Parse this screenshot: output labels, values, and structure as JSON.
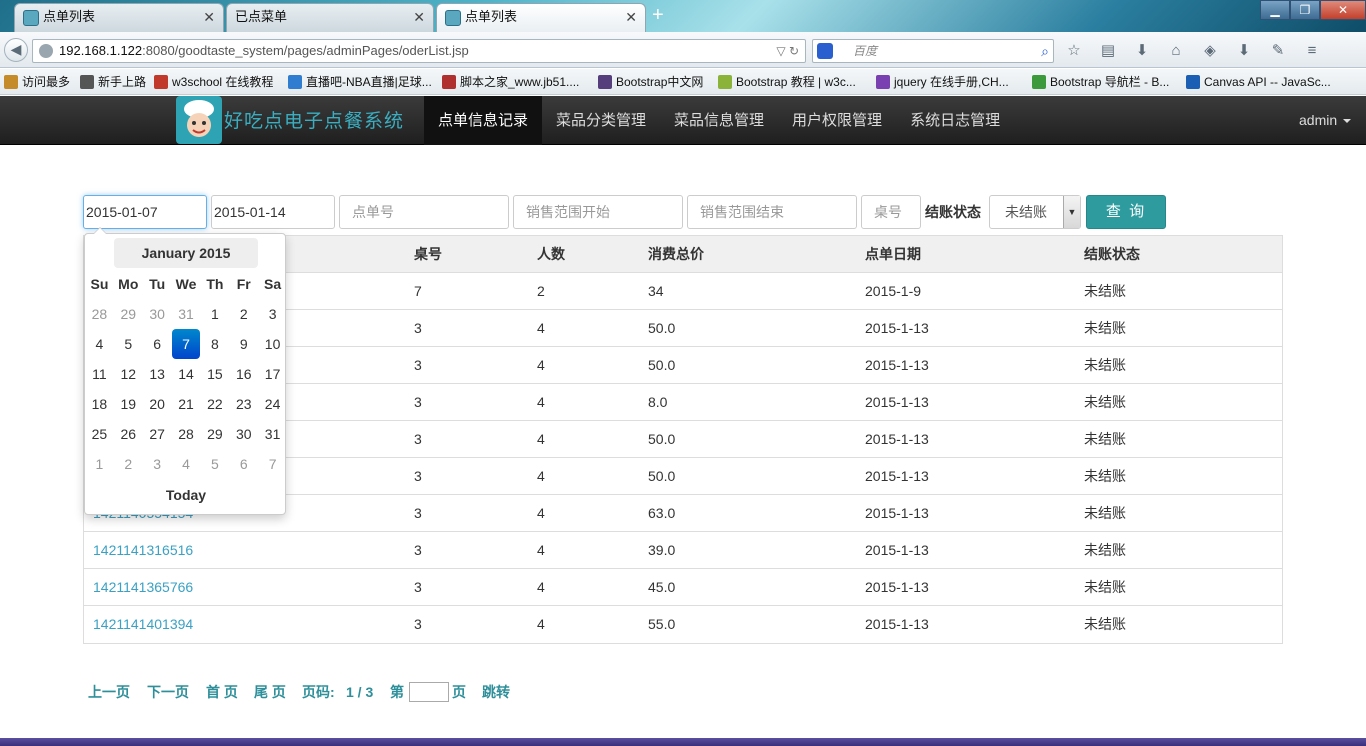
{
  "browser": {
    "tabs": [
      {
        "label": "点单列表",
        "active": false
      },
      {
        "label": "已点菜单",
        "active": false
      },
      {
        "label": "点单列表",
        "active": true
      }
    ],
    "url_host": "192.168.1.122",
    "url_path": ":8080/goodtaste_system/pages/adminPages/oderList.jsp",
    "search_placeholder": "百度",
    "bookmarks": [
      "访问最多",
      "新手上路",
      "w3school 在线教程",
      "直播吧-NBA直播|足球...",
      "脚本之家_www.jb51....",
      "Bootstrap中文网",
      "Bootstrap 教程 | w3c...",
      "jquery 在线手册,CH...",
      "Bootstrap 导航栏 - B...",
      "Canvas API -- JavaSc..."
    ]
  },
  "app": {
    "brand": "好吃点电子点餐系统",
    "nav": [
      "点单信息记录",
      "菜品分类管理",
      "菜品信息管理",
      "用户权限管理",
      "系统日志管理"
    ],
    "user": "admin"
  },
  "filters": {
    "start_date": "2015-01-07",
    "end_date": "2015-01-14",
    "order_no_placeholder": "点单号",
    "sales_from_placeholder": "销售范围开始",
    "sales_to_placeholder": "销售范围结束",
    "table_no_placeholder": "桌号",
    "status_label": "结账状态",
    "status_value": "未结账",
    "query_button": "查 询"
  },
  "table": {
    "headers": [
      "",
      "桌号",
      "人数",
      "消费总价",
      "点单日期",
      "结账状态"
    ],
    "rows": [
      [
        "",
        "7",
        "2",
        "34",
        "2015-1-9",
        "未结账"
      ],
      [
        "",
        "3",
        "4",
        "50.0",
        "2015-1-13",
        "未结账"
      ],
      [
        "",
        "3",
        "4",
        "50.0",
        "2015-1-13",
        "未结账"
      ],
      [
        "",
        "3",
        "4",
        "8.0",
        "2015-1-13",
        "未结账"
      ],
      [
        "",
        "3",
        "4",
        "50.0",
        "2015-1-13",
        "未结账"
      ],
      [
        "",
        "3",
        "4",
        "50.0",
        "2015-1-13",
        "未结账"
      ],
      [
        "1421140554154",
        "3",
        "4",
        "63.0",
        "2015-1-13",
        "未结账"
      ],
      [
        "1421141316516",
        "3",
        "4",
        "39.0",
        "2015-1-13",
        "未结账"
      ],
      [
        "1421141365766",
        "3",
        "4",
        "45.0",
        "2015-1-13",
        "未结账"
      ],
      [
        "1421141401394",
        "3",
        "4",
        "55.0",
        "2015-1-13",
        "未结账"
      ]
    ]
  },
  "datepicker": {
    "month_title": "January 2015",
    "weekdays": [
      "Su",
      "Mo",
      "Tu",
      "We",
      "Th",
      "Fr",
      "Sa"
    ],
    "weeks": [
      [
        "28",
        "29",
        "30",
        "31",
        "1",
        "2",
        "3"
      ],
      [
        "4",
        "5",
        "6",
        "7",
        "8",
        "9",
        "10"
      ],
      [
        "11",
        "12",
        "13",
        "14",
        "15",
        "16",
        "17"
      ],
      [
        "18",
        "19",
        "20",
        "21",
        "22",
        "23",
        "24"
      ],
      [
        "25",
        "26",
        "27",
        "28",
        "29",
        "30",
        "31"
      ],
      [
        "1",
        "2",
        "3",
        "4",
        "5",
        "6",
        "7"
      ]
    ],
    "selected_day": "7",
    "today_label": "Today"
  },
  "pager": {
    "prev": "上一页",
    "next": "下一页",
    "first": "首 页",
    "last": "尾 页",
    "page_label": "页码:",
    "page_value": "1 / 3",
    "goto_prefix": "第",
    "goto_suffix": "页",
    "jump": "跳转"
  }
}
